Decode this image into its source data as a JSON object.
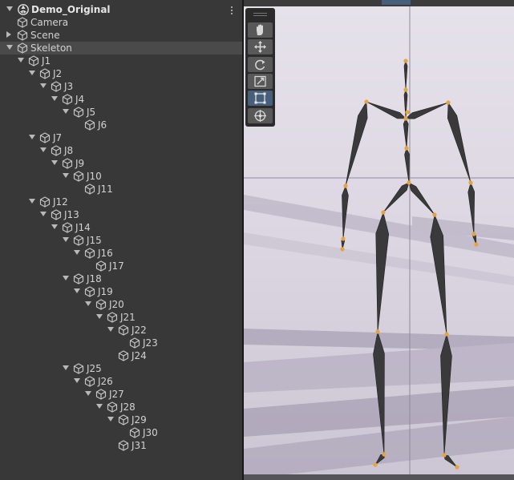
{
  "hierarchy": {
    "root": {
      "label": "Demo_Original"
    },
    "items": [
      {
        "label": "Camera",
        "depth": 1,
        "arrow": "none"
      },
      {
        "label": "Scene",
        "depth": 1,
        "arrow": "collapsed"
      },
      {
        "label": "Skeleton",
        "depth": 1,
        "arrow": "expanded",
        "selected": true
      },
      {
        "label": "J1",
        "depth": 2,
        "arrow": "expanded"
      },
      {
        "label": "J2",
        "depth": 3,
        "arrow": "expanded"
      },
      {
        "label": "J3",
        "depth": 4,
        "arrow": "expanded"
      },
      {
        "label": "J4",
        "depth": 5,
        "arrow": "expanded"
      },
      {
        "label": "J5",
        "depth": 6,
        "arrow": "expanded"
      },
      {
        "label": "J6",
        "depth": 7,
        "arrow": "none"
      },
      {
        "label": "J7",
        "depth": 3,
        "arrow": "expanded"
      },
      {
        "label": "J8",
        "depth": 4,
        "arrow": "expanded"
      },
      {
        "label": "J9",
        "depth": 5,
        "arrow": "expanded"
      },
      {
        "label": "J10",
        "depth": 6,
        "arrow": "expanded"
      },
      {
        "label": "J11",
        "depth": 7,
        "arrow": "none"
      },
      {
        "label": "J12",
        "depth": 3,
        "arrow": "expanded"
      },
      {
        "label": "J13",
        "depth": 4,
        "arrow": "expanded"
      },
      {
        "label": "J14",
        "depth": 5,
        "arrow": "expanded"
      },
      {
        "label": "J15",
        "depth": 6,
        "arrow": "expanded"
      },
      {
        "label": "J16",
        "depth": 7,
        "arrow": "expanded"
      },
      {
        "label": "J17",
        "depth": 8,
        "arrow": "none"
      },
      {
        "label": "J18",
        "depth": 6,
        "arrow": "expanded"
      },
      {
        "label": "J19",
        "depth": 7,
        "arrow": "expanded"
      },
      {
        "label": "J20",
        "depth": 8,
        "arrow": "expanded"
      },
      {
        "label": "J21",
        "depth": 9,
        "arrow": "expanded"
      },
      {
        "label": "J22",
        "depth": 10,
        "arrow": "expanded"
      },
      {
        "label": "J23",
        "depth": 11,
        "arrow": "none"
      },
      {
        "label": "J24",
        "depth": 10,
        "arrow": "none"
      },
      {
        "label": "J25",
        "depth": 6,
        "arrow": "expanded"
      },
      {
        "label": "J26",
        "depth": 7,
        "arrow": "expanded"
      },
      {
        "label": "J27",
        "depth": 8,
        "arrow": "expanded"
      },
      {
        "label": "J28",
        "depth": 9,
        "arrow": "expanded"
      },
      {
        "label": "J29",
        "depth": 10,
        "arrow": "expanded"
      },
      {
        "label": "J30",
        "depth": 11,
        "arrow": "none"
      },
      {
        "label": "J31",
        "depth": 10,
        "arrow": "none"
      }
    ]
  },
  "scene_view": {
    "tools": [
      {
        "name": "hand-tool",
        "icon": "hand-icon",
        "active": false
      },
      {
        "name": "move-tool",
        "icon": "move-arrows-icon",
        "active": false
      },
      {
        "name": "rotate-tool",
        "icon": "rotate-icon",
        "active": false
      },
      {
        "name": "scale-tool",
        "icon": "scale-icon",
        "active": false
      },
      {
        "name": "rect-tool",
        "icon": "rect-transform-icon",
        "active": true
      },
      {
        "name": "transform-tool",
        "icon": "transform-icon",
        "active": false
      }
    ],
    "joint_color": "#e6a43c",
    "bone_color": "#3a3a3a",
    "background_color": "#dcd6e2",
    "active_tool_color": "#46607c"
  }
}
